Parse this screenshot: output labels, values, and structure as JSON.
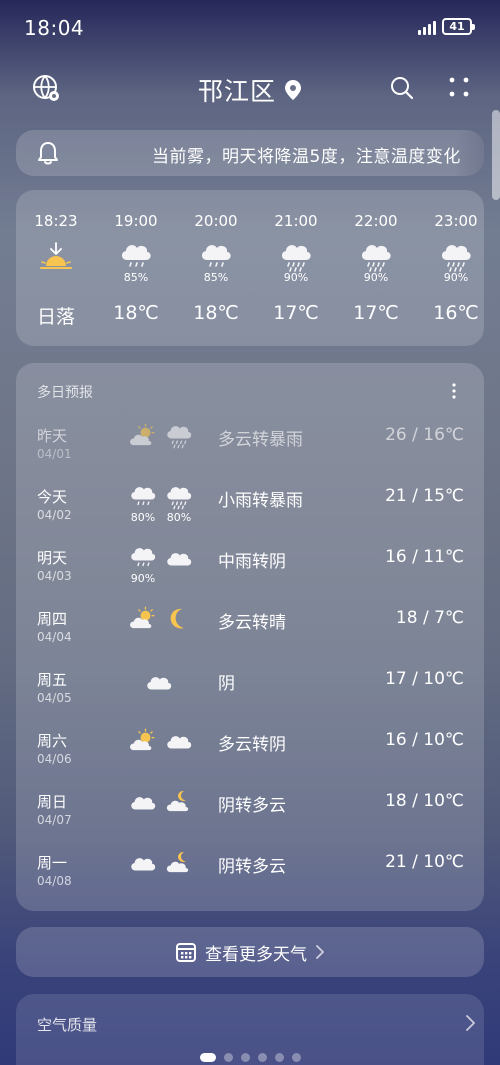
{
  "status": {
    "time": "18:04",
    "battery": "41"
  },
  "header": {
    "city": "邗江区"
  },
  "alert": {
    "text": "当前雾，明天将降温5度，注意温度变化"
  },
  "hourly": [
    {
      "time": "18:23",
      "icon": "sunset-icon",
      "pct": "",
      "temp": "日落"
    },
    {
      "time": "19:00",
      "icon": "light-rain-icon",
      "pct": "85%",
      "temp": "18℃"
    },
    {
      "time": "20:00",
      "icon": "light-rain-icon",
      "pct": "85%",
      "temp": "18℃"
    },
    {
      "time": "21:00",
      "icon": "heavy-rain-icon",
      "pct": "90%",
      "temp": "17℃"
    },
    {
      "time": "22:00",
      "icon": "heavy-rain-icon",
      "pct": "90%",
      "temp": "17℃"
    },
    {
      "time": "23:00",
      "icon": "heavy-rain-icon",
      "pct": "90%",
      "temp": "16℃"
    }
  ],
  "daily": {
    "title": "多日预报",
    "days": [
      {
        "day": "昨天",
        "date": "04/01",
        "icon1": "partly-cloudy-icon",
        "icon2": "heavy-rain-icon",
        "pct1": "",
        "pct2": "",
        "desc": "多云转暴雨",
        "range": "26 / 16℃"
      },
      {
        "day": "今天",
        "date": "04/02",
        "icon1": "light-rain-icon",
        "icon2": "heavy-rain-icon",
        "pct1": "80%",
        "pct2": "80%",
        "desc": "小雨转暴雨",
        "range": "21 / 15℃"
      },
      {
        "day": "明天",
        "date": "04/03",
        "icon1": "moderate-rain-icon",
        "icon2": "cloudy-icon",
        "pct1": "90%",
        "pct2": "",
        "desc": "中雨转阴",
        "range": "16 / 11℃"
      },
      {
        "day": "周四",
        "date": "04/04",
        "icon1": "partly-cloudy-icon",
        "icon2": "moon-icon",
        "pct1": "",
        "pct2": "",
        "desc": "多云转晴",
        "range": "18 / 7℃"
      },
      {
        "day": "周五",
        "date": "04/05",
        "icon1": "",
        "icon2": "",
        "pct1": "",
        "pct2": "",
        "desc": "阴",
        "range": "17 / 10℃"
      },
      {
        "day": "周六",
        "date": "04/06",
        "icon1": "partly-cloudy-icon",
        "icon2": "cloudy-icon",
        "pct1": "",
        "pct2": "",
        "desc": "多云转阴",
        "range": "16 / 10℃"
      },
      {
        "day": "周日",
        "date": "04/07",
        "icon1": "cloudy-icon",
        "icon2": "cloudy-night-icon",
        "pct1": "",
        "pct2": "",
        "desc": "阴转多云",
        "range": "18 / 10℃"
      },
      {
        "day": "周一",
        "date": "04/08",
        "icon1": "cloudy-icon",
        "icon2": "cloudy-night-icon",
        "pct1": "",
        "pct2": "",
        "desc": "阴转多云",
        "range": "21 / 10℃"
      }
    ]
  },
  "more_button": {
    "label": "查看更多天气"
  },
  "air_quality": {
    "label": "空气质量"
  },
  "pager": {
    "count": 6,
    "active": 1
  }
}
